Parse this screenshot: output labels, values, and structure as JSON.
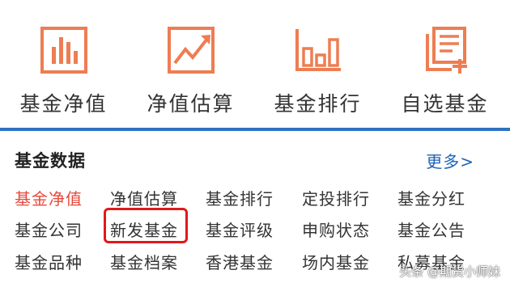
{
  "colors": {
    "accent": "#ee7d52",
    "active_text": "#e8483b",
    "divider": "#2e72c0",
    "link": "#1d63b5",
    "highlight_border": "#e0191a"
  },
  "top_nav": [
    {
      "label": "基金净值",
      "icon": "bar-chart-icon"
    },
    {
      "label": "净值估算",
      "icon": "trend-line-icon"
    },
    {
      "label": "基金排行",
      "icon": "ranking-bars-icon"
    },
    {
      "label": "自选基金",
      "icon": "document-add-icon"
    }
  ],
  "section": {
    "title": "基金数据",
    "more_label": "更多>"
  },
  "grid": [
    [
      "基金净值",
      "净值估算",
      "基金排行",
      "定投排行",
      "基金分红"
    ],
    [
      "基金公司",
      "新发基金",
      "基金评级",
      "申购状态",
      "基金公告"
    ],
    [
      "基金品种",
      "基金档案",
      "香港基金",
      "场内基金",
      "私募基金"
    ]
  ],
  "active_item": "基金净值",
  "highlighted_item": "新发基金",
  "watermark": "头条 @期货小师妹"
}
